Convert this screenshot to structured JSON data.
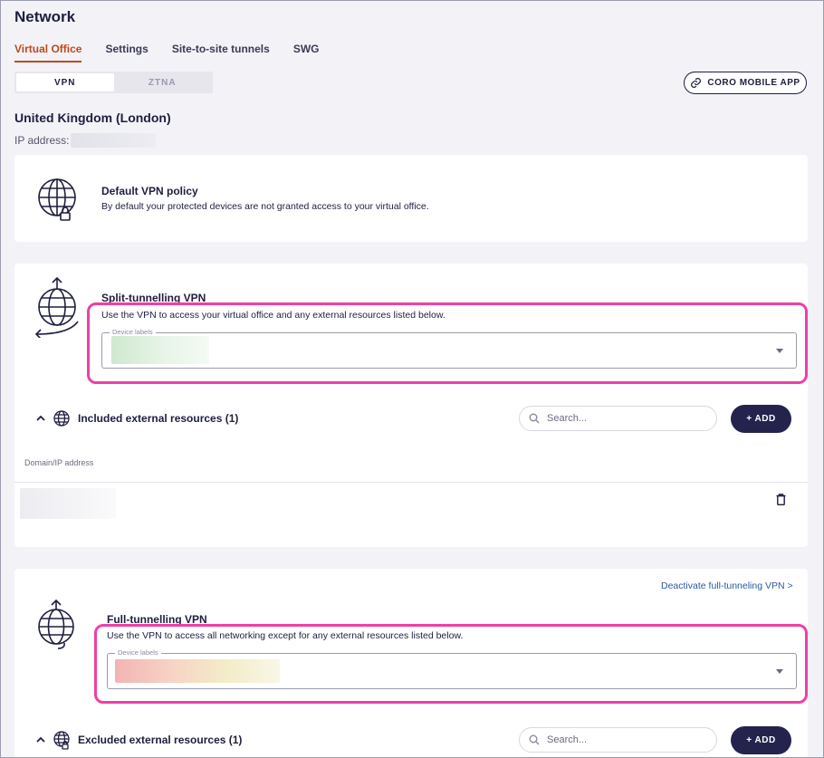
{
  "page": {
    "title": "Network"
  },
  "tabs": [
    {
      "label": "Virtual Office",
      "active": true
    },
    {
      "label": "Settings",
      "active": false
    },
    {
      "label": "Site-to-site tunnels",
      "active": false
    },
    {
      "label": "SWG",
      "active": false
    }
  ],
  "mode_toggle": {
    "vpn_label": "VPN",
    "ztna_label": "ZTNA",
    "selected": "VPN"
  },
  "mobile_app_button": {
    "label": "CORO MOBILE APP",
    "icon": "link-icon"
  },
  "location": {
    "name": "United Kingdom (London)",
    "ip_label": "IP address:"
  },
  "default_policy": {
    "title": "Default VPN policy",
    "description": "By default your protected devices are not granted access to your virtual office.",
    "icon": "globe-lock-icon"
  },
  "split_tunnel": {
    "title": "Split-tunnelling VPN",
    "description": "Use the VPN to access your virtual office and any external resources listed below.",
    "device_labels_label": "Device labels",
    "icon": "globe-split-icon",
    "resources": {
      "title": "Included external resources (1)",
      "search_placeholder": "Search...",
      "add_label": "+ ADD",
      "column_header": "Domain/IP address"
    }
  },
  "full_tunnel": {
    "title": "Full-tunnelling VPN",
    "description": "Use the VPN to access all networking except for any external resources listed below.",
    "device_labels_label": "Device labels",
    "deactivate_link": "Deactivate full-tunneling VPN >",
    "icon": "globe-full-icon",
    "resources": {
      "title": "Excluded external resources (1)",
      "search_placeholder": "Search...",
      "add_label": "+ ADD"
    }
  },
  "colors": {
    "accent": "#c0481a",
    "primary": "#23234d",
    "highlight": "#ee3fa6",
    "link": "#2a5aa0"
  }
}
